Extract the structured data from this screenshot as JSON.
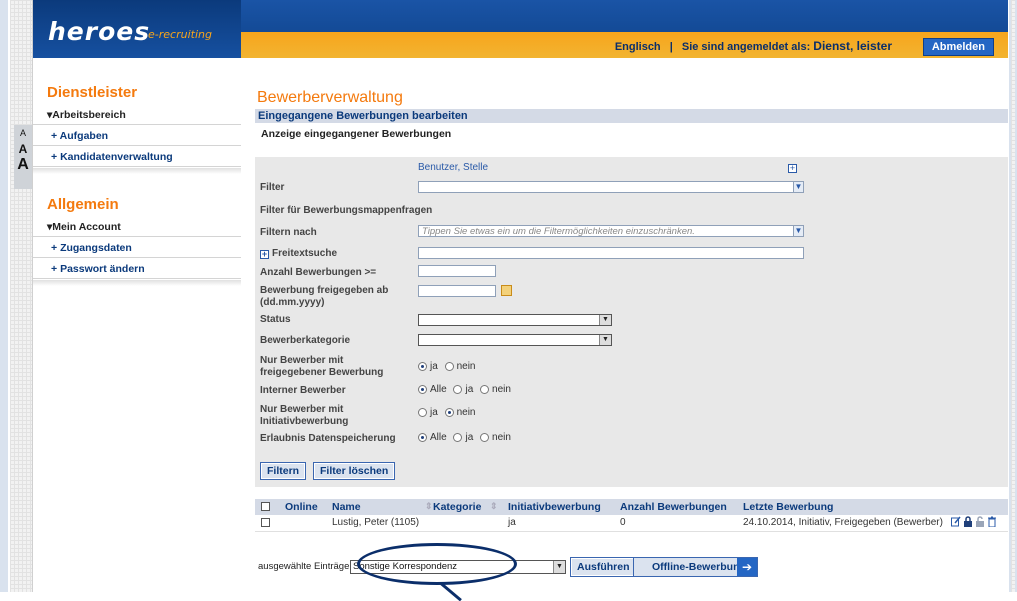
{
  "header": {
    "logo_main": "heroes",
    "logo_sub": "e-recruiting",
    "language": "Englisch",
    "separator": "|",
    "logged_in_label": "Sie sind angemeldet als:",
    "logged_in_user": "Dienst, leister",
    "logout_button": "Abmelden"
  },
  "font_size_control": [
    "A",
    "A",
    "A"
  ],
  "sidebar": {
    "section1_title": "Dienstleister",
    "section1_group": "Arbeitsbereich",
    "section1_items": [
      "Aufgaben",
      "Kandidatenverwaltung"
    ],
    "section2_title": "Allgemein",
    "section2_group": "Mein Account",
    "section2_items": [
      "Zugangsdaten",
      "Passwort ändern"
    ]
  },
  "main": {
    "title": "Bewerberverwaltung",
    "section_title": "Eingegangene Bewerbungen bearbeiten",
    "section_subtitle": "Anzeige eingegangener Bewerbungen"
  },
  "filter": {
    "filter_header_value": "Benutzer, Stelle",
    "labels": {
      "filter": "Filter",
      "application_folder_questions": "Filter für Bewerbungsmappenfragen",
      "filter_by": "Filtern nach",
      "free_text": "Freitextsuche",
      "num_applications": "Anzahl Bewerbungen >=",
      "released_from": "Bewerbung freigegeben ab (dd.mm.yyyy)",
      "status": "Status",
      "category": "Bewerberkategorie",
      "only_released": "Nur Bewerber mit freigegebener Bewerbung",
      "internal": "Interner Bewerber",
      "only_initiative": "Nur Bewerber mit Initiativbewerbung",
      "data_storage": "Erlaubnis Datenspeicherung"
    },
    "filter_by_placeholder": "Tippen Sie etwas ein um die Filtermöglichkeiten einzuschränken.",
    "radio_only_released": {
      "options": [
        "ja",
        "nein"
      ],
      "selected": "ja"
    },
    "radio_internal": {
      "options": [
        "Alle",
        "ja",
        "nein"
      ],
      "selected": "Alle"
    },
    "radio_only_initiative": {
      "options": [
        "ja",
        "nein"
      ],
      "selected": "nein"
    },
    "radio_data_storage": {
      "options": [
        "Alle",
        "ja",
        "nein"
      ],
      "selected": "Alle"
    },
    "button_filter": "Filtern",
    "button_clear": "Filter löschen"
  },
  "table": {
    "columns": [
      "Online",
      "Name",
      "Kategorie",
      "Initiativbewerbung",
      "Anzahl Bewerbungen",
      "Letzte Bewerbung"
    ],
    "rows": [
      {
        "online": "",
        "name": "Lustig, Peter (1105)",
        "kategorie": "",
        "initiativ": "ja",
        "anzahl": "0",
        "letzte": "24.10.2014, Initiativ, Freigegeben (Bewerber)"
      }
    ]
  },
  "bottom": {
    "selected_label": "ausgewählte Einträge",
    "action_select_value": "Sonstige Korrespondenz",
    "execute_button": "Ausführen",
    "offline_button": "Offline-Bewerbung"
  },
  "colors": {
    "brand_blue": "#134a96",
    "brand_orange": "#f7a51c",
    "heading_orange": "#f47a0e"
  }
}
